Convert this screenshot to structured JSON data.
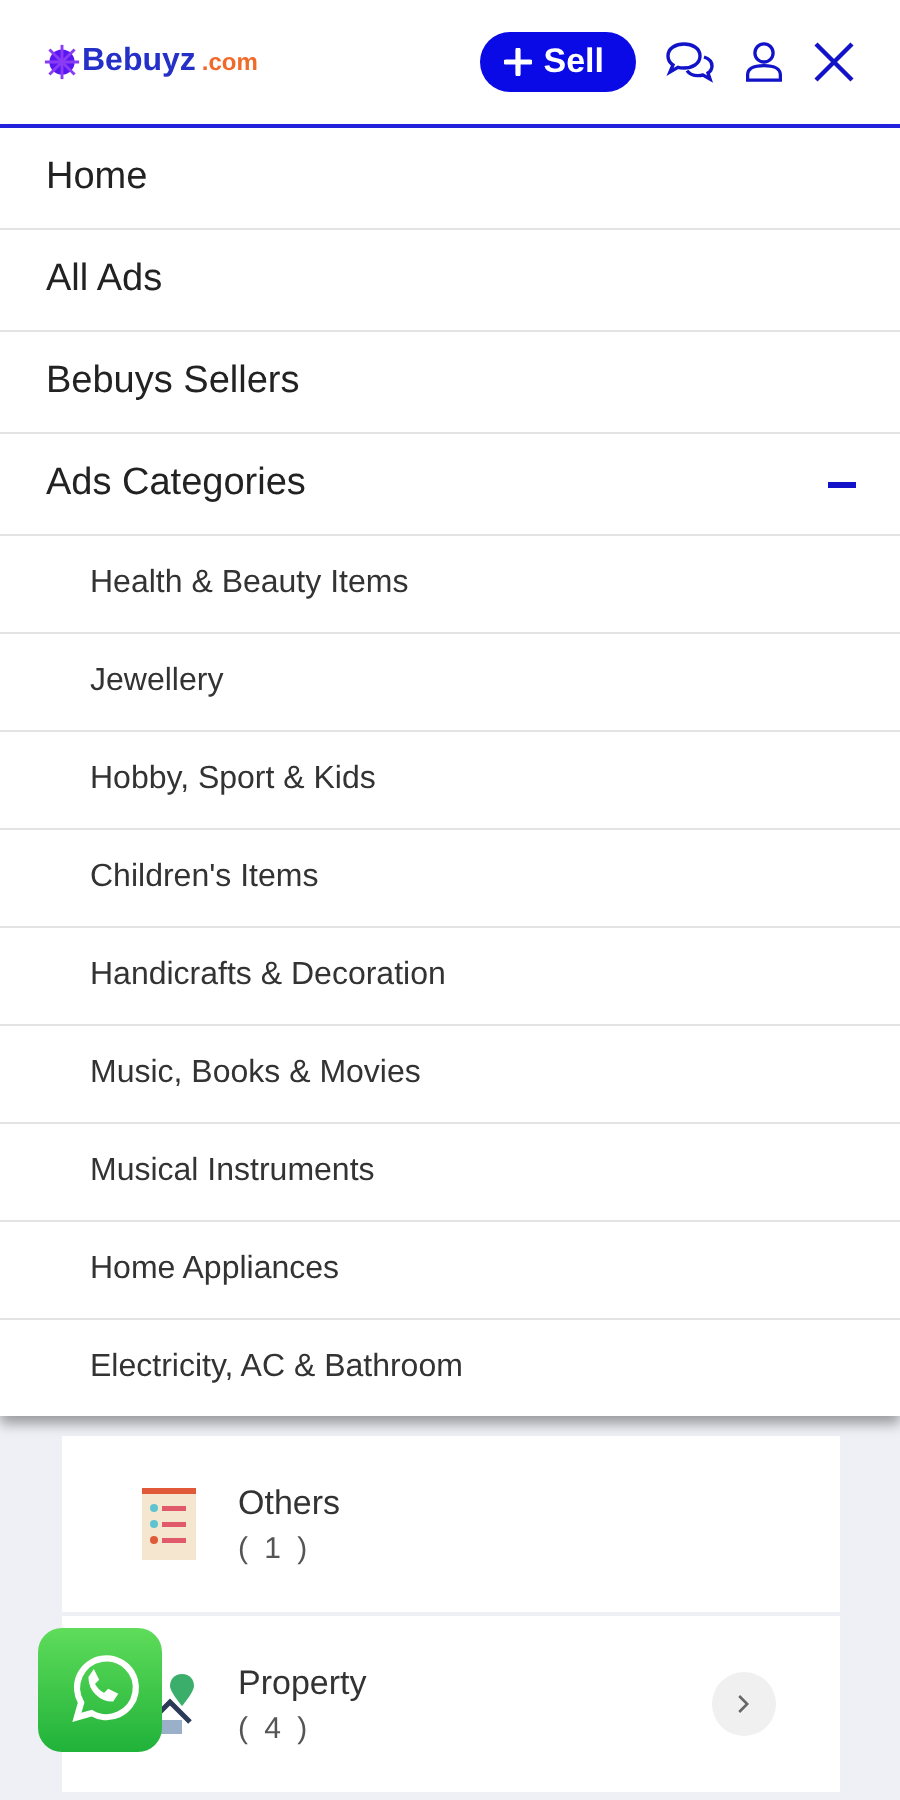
{
  "header": {
    "logo": {
      "name": "Bebuyz",
      "suffix": ".com"
    },
    "sell_button": {
      "label": "Sell"
    }
  },
  "menu": [
    {
      "label": "Home"
    },
    {
      "label": "All Ads"
    },
    {
      "label": "Bebuys Sellers"
    },
    {
      "label": "Ads Categories",
      "expanded": true,
      "children": [
        {
          "label": "Health & Beauty Items"
        },
        {
          "label": "Jewellery"
        },
        {
          "label": "Hobby, Sport & Kids"
        },
        {
          "label": "Children's Items"
        },
        {
          "label": "Handicrafts & Decoration"
        },
        {
          "label": "Music, Books & Movies"
        },
        {
          "label": "Musical Instruments"
        },
        {
          "label": "Home Appliances"
        },
        {
          "label": "Electricity, AC & Bathroom"
        }
      ]
    }
  ],
  "categories": [
    {
      "name": "Others",
      "count": "( 1 )",
      "kind": "list",
      "chevron": false
    },
    {
      "name": "Property",
      "count": "( 4 )",
      "kind": "house",
      "chevron": true
    }
  ]
}
